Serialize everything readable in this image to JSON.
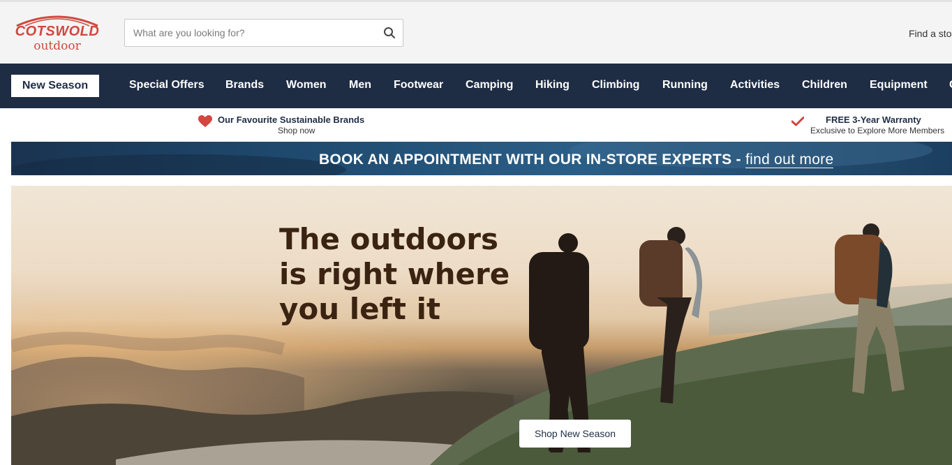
{
  "header": {
    "logo": {
      "line1": "COTSWOLD",
      "line2": "outdoor",
      "color": "#d2473f"
    },
    "search": {
      "placeholder": "What are you looking for?",
      "value": "",
      "icon": "search-icon"
    },
    "find_store": "Find a sto"
  },
  "nav": {
    "background": "#1e2d44",
    "items": [
      {
        "label": "New Season",
        "highlighted": true
      },
      {
        "label": "Special Offers"
      },
      {
        "label": "Brands"
      },
      {
        "label": "Women"
      },
      {
        "label": "Men"
      },
      {
        "label": "Footwear"
      },
      {
        "label": "Camping"
      },
      {
        "label": "Hiking"
      },
      {
        "label": "Climbing"
      },
      {
        "label": "Running"
      },
      {
        "label": "Activities"
      },
      {
        "label": "Children"
      },
      {
        "label": "Equipment"
      },
      {
        "label": "C"
      }
    ]
  },
  "usps": [
    {
      "icon": "heart-icon",
      "title": "Our Favourite Sustainable Brands",
      "subtitle": "Shop now"
    },
    {
      "icon": "checkmark-icon",
      "title": "FREE 3-Year Warranty",
      "subtitle": "Exclusive to Explore More Members"
    }
  ],
  "banner": {
    "text": "BOOK AN APPOINTMENT WITH OUR IN-STORE EXPERTS - ",
    "link": "find out more"
  },
  "hero": {
    "title_lines": [
      "The outdoors",
      "is right where",
      "you left it"
    ],
    "cta": "Shop New Season"
  }
}
